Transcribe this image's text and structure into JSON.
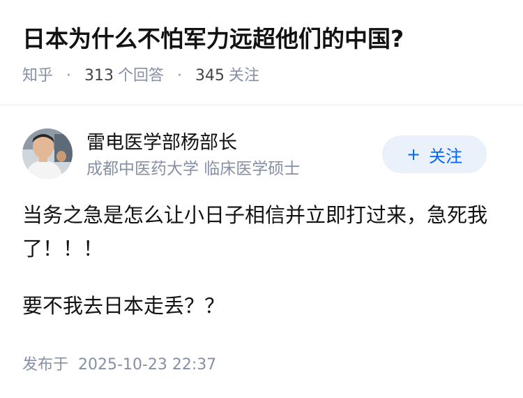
{
  "question": {
    "title": "日本为什么不怕军力远超他们的中国?",
    "source": "知乎",
    "answers_count": "313",
    "answers_label": "个回答",
    "followers_count": "345",
    "followers_label": "关注"
  },
  "author": {
    "name": "雷电医学部杨部长",
    "description": "成都中医药大学 临床医学硕士",
    "follow_label": "关注",
    "follow_icon": "plus-icon"
  },
  "answer": {
    "paragraphs": [
      "当务之急是怎么让小日子相信并立即打过来，急死我了！！！",
      "要不我去日本走丢？？"
    ]
  },
  "footer": {
    "published_label": "发布于",
    "published_date": "2025-10-23 22:37"
  },
  "colors": {
    "meta_gray": "#8590a6",
    "follow_bg": "#ebf1fa",
    "follow_text": "#0066ff"
  }
}
